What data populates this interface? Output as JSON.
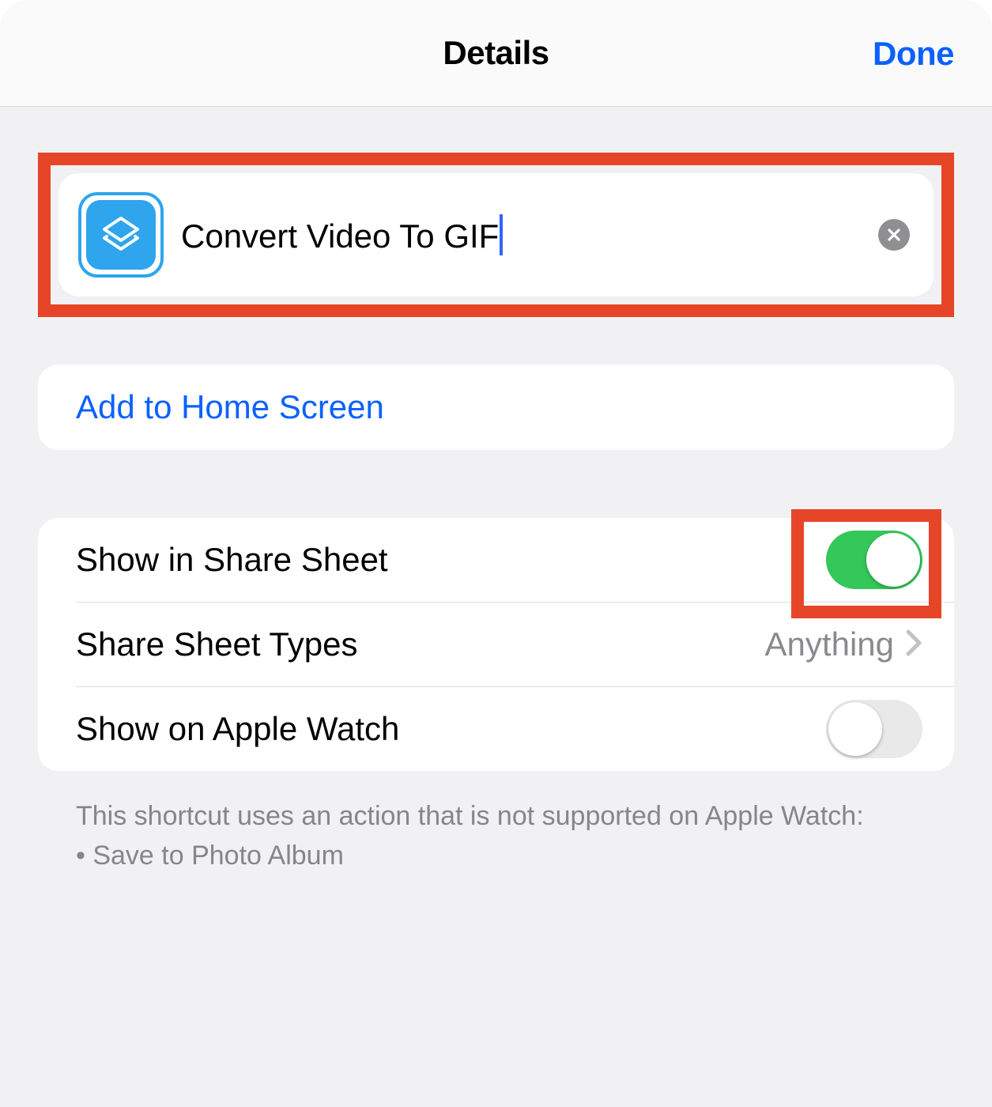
{
  "header": {
    "title": "Details",
    "done_label": "Done"
  },
  "shortcut": {
    "name": "Convert Video To GIF"
  },
  "actions": {
    "add_to_home_screen": "Add to Home Screen"
  },
  "settings": {
    "share_sheet": {
      "label": "Show in Share Sheet",
      "on": true
    },
    "share_sheet_types": {
      "label": "Share Sheet Types",
      "value": "Anything"
    },
    "apple_watch": {
      "label": "Show on Apple Watch",
      "on": false
    }
  },
  "footer": {
    "line1": "This shortcut uses an action that is not supported on Apple Watch:",
    "bullet1": "• Save to Photo Album"
  }
}
